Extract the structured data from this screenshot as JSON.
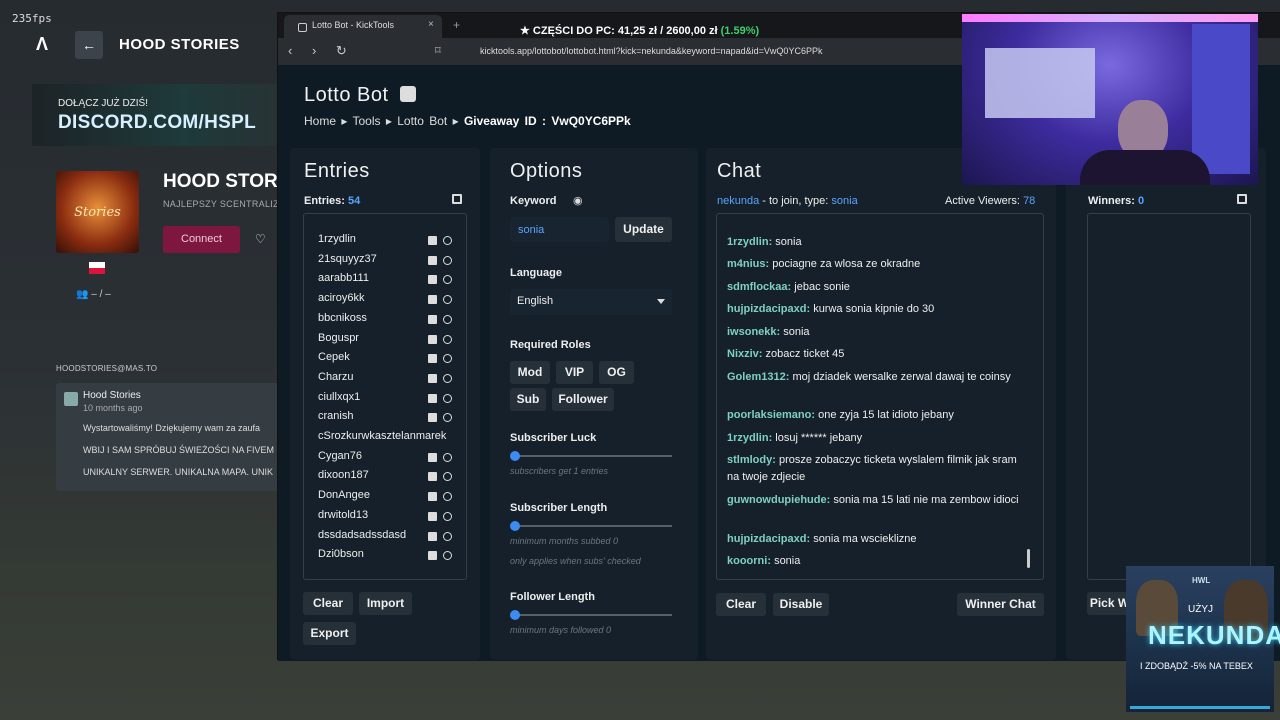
{
  "overlay": {
    "fps": "235fps"
  },
  "site": {
    "logo_glyph": "Λ",
    "back_glyph": "←",
    "title": "HOOD STORIES",
    "discord_line1": "DOŁĄCZ JUŻ DZIŚ!",
    "discord_line2": "DISCORD.COM/HSPL",
    "server_logo_text": "Stories",
    "server_name": "HOOD STORI",
    "server_tagline": "NAJLEPSZY SCENTRALIZ",
    "connect": "Connect",
    "players": "– / –",
    "mastodon_label": "HOODSTORIES@MAS.TO",
    "post": {
      "name": "Hood Stories",
      "time": "10 months ago",
      "line1": "Wystartowaliśmy! Dziękujemy wam za zaufa",
      "line2": "WBIJ I SAM SPRÓBUJ ŚWIEŻOŚCI NA FIVEM",
      "line3": "UNIKALNY SERWER. UNIKALNA MAPA. UNIK"
    }
  },
  "browser": {
    "tab_title": "Lotto Bot - KickTools",
    "tab_close": "×",
    "new_tab": "+",
    "nav": "‹ › ↻",
    "url": "kicktools.app/lottobot/lottobot.html?kick=nekunda&keyword=napad&id=VwQ0YC6PPk"
  },
  "stream_overlay": {
    "prefix": "★ CZĘŚCI DO PC:",
    "current": "41,25 zł",
    "sep": "/",
    "goal": "2600,00 zł",
    "pct": "(1.59%)"
  },
  "lotto": {
    "title": "Lotto Bot",
    "breadcrumb": {
      "home": "Home",
      "tools": "Tools",
      "lotto": "Lotto Bot",
      "gid_label": "Giveaway ID :",
      "gid": "VwQ0YC6PPk"
    },
    "entries": {
      "heading": "Entries",
      "count_label": "Entries:",
      "count": "54",
      "items": [
        "1rzydlin",
        "21squyyz37",
        "aarabb111",
        "aciroy6kk",
        "bbcnikoss",
        "Boguspr",
        "Cepek",
        "Charzu",
        "ciullxqx1",
        "cranish",
        "cSrozkurwkasztelanmarek",
        "Cygan76",
        "dixoon187",
        "DonAngee",
        "drwitold13",
        "dssdadsadssdasd",
        "Dzi0bson"
      ],
      "clear": "Clear",
      "import": "Import",
      "export": "Export"
    },
    "options": {
      "heading": "Options",
      "keyword_label": "Keyword",
      "keyword_value": "sonia",
      "update": "Update",
      "language_label": "Language",
      "language_value": "English",
      "roles_label": "Required Roles",
      "roles": [
        "Mod",
        "VIP",
        "OG",
        "Sub",
        "Follower"
      ],
      "sub_luck_label": "Subscriber Luck",
      "sub_luck_hint": "subscribers get 1 entries",
      "sub_len_label": "Subscriber Length",
      "sub_len_hint1": "minimum months subbed 0",
      "sub_len_hint2": "only applies when subs' checked",
      "fol_len_label": "Follower Length",
      "fol_len_hint": "minimum days followed 0"
    },
    "chat": {
      "heading": "Chat",
      "channel": "nekunda",
      "join_text": "- to join, type:",
      "join_keyword": "sonia",
      "viewers_label": "Active Viewers:",
      "viewers": "78",
      "messages": [
        {
          "user": "1rzydlin:",
          "text": "sonia"
        },
        {
          "user": "m4nius:",
          "text": "pociagne za wlosa ze okradne"
        },
        {
          "user": "sdmflockaa:",
          "text": "jebac sonie"
        },
        {
          "user": "hujpizdacipaxd:",
          "text": "kurwa sonia kipnie do 30"
        },
        {
          "user": "iwsonekk:",
          "text": "sonia"
        },
        {
          "user": "Nixziv:",
          "text": "zobacz ticket 45"
        },
        {
          "user": "Golem1312:",
          "text": "moj dziadek wersalke zerwal dawaj te coinsy"
        },
        {
          "user": "poorlaksiemano:",
          "text": "one zyja 15 lat idioto jebany"
        },
        {
          "user": "1rzydlin:",
          "text": "losuj ****** jebany"
        },
        {
          "user": "stlmlody:",
          "text": "prosze zobaczyc ticketa wyslalem filmik jak sram na twoje zdjecie"
        },
        {
          "user": "guwnowdupiehude:",
          "text": "sonia ma 15 lati nie ma zembow idioci"
        },
        {
          "user": "hujpizdacipaxd:",
          "text": "sonia ma wscieklizne"
        },
        {
          "user": "kooorni:",
          "text": "sonia"
        }
      ],
      "clear": "Clear",
      "disable": "Disable",
      "winner_chat": "Winner Chat"
    },
    "winners": {
      "label": "Winners:",
      "count": "0",
      "pick": "Pick W"
    }
  },
  "ad": {
    "top": "HWL",
    "use": "UŻYJ",
    "code": "NEKUNDA",
    "promo": "I ZDOBĄDŹ -5% NA TEBEX"
  }
}
